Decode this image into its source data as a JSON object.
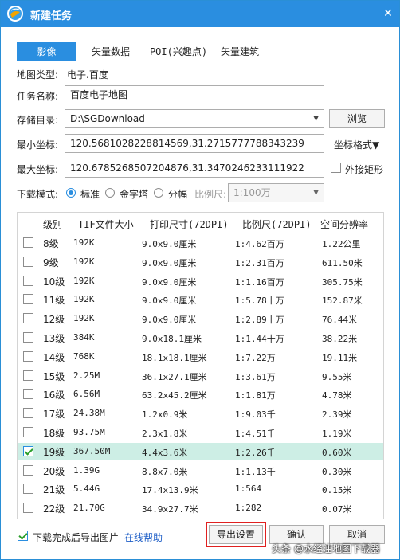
{
  "window": {
    "title": "新建任务",
    "close": "✕"
  },
  "tabs": [
    "影像",
    "矢量数据",
    "POI(兴趣点)",
    "矢量建筑"
  ],
  "map_type": {
    "label": "地图类型:",
    "value": "电子.百度"
  },
  "task_name": {
    "label": "任务名称:",
    "value": "百度电子地图"
  },
  "storage": {
    "label": "存储目录:",
    "value": "D:\\SGDownload",
    "browse": "浏览"
  },
  "min_coord": {
    "label": "最小坐标:",
    "value": "120.5681028228814569,31.2715777788343239"
  },
  "coord_format": "坐标格式▼",
  "max_coord": {
    "label": "最大坐标:",
    "value": "120.6785268507204876,31.3470246233111922"
  },
  "bounding_rect": "外接矩形",
  "download_mode": {
    "label": "下载模式:",
    "options": [
      "标准",
      "金字塔",
      "分幅"
    ],
    "scale_label": "比例尺:",
    "scale_value": "1:100万"
  },
  "table": {
    "headers": [
      "级别",
      "TIF文件大小",
      "打印尺寸(72DPI)",
      "比例尺(72DPI)",
      "空间分辨率"
    ],
    "rows": [
      {
        "level": "8级",
        "size": "192K",
        "print": "9.0x9.0厘米",
        "scale": "1:4.62百万",
        "res": "1.22公里",
        "checked": false
      },
      {
        "level": "9级",
        "size": "192K",
        "print": "9.0x9.0厘米",
        "scale": "1:2.31百万",
        "res": "611.50米",
        "checked": false
      },
      {
        "level": "10级",
        "size": "192K",
        "print": "9.0x9.0厘米",
        "scale": "1:1.16百万",
        "res": "305.75米",
        "checked": false
      },
      {
        "level": "11级",
        "size": "192K",
        "print": "9.0x9.0厘米",
        "scale": "1:5.78十万",
        "res": "152.87米",
        "checked": false
      },
      {
        "level": "12级",
        "size": "192K",
        "print": "9.0x9.0厘米",
        "scale": "1:2.89十万",
        "res": "76.44米",
        "checked": false
      },
      {
        "level": "13级",
        "size": "384K",
        "print": "9.0x18.1厘米",
        "scale": "1:1.44十万",
        "res": "38.22米",
        "checked": false
      },
      {
        "level": "14级",
        "size": "768K",
        "print": "18.1x18.1厘米",
        "scale": "1:7.22万",
        "res": "19.11米",
        "checked": false
      },
      {
        "level": "15级",
        "size": "2.25M",
        "print": "36.1x27.1厘米",
        "scale": "1:3.61万",
        "res": "9.55米",
        "checked": false
      },
      {
        "level": "16级",
        "size": "6.56M",
        "print": "63.2x45.2厘米",
        "scale": "1:1.81万",
        "res": "4.78米",
        "checked": false
      },
      {
        "level": "17级",
        "size": "24.38M",
        "print": "1.2x0.9米",
        "scale": "1:9.03千",
        "res": "2.39米",
        "checked": false
      },
      {
        "level": "18级",
        "size": "93.75M",
        "print": "2.3x1.8米",
        "scale": "1:4.51千",
        "res": "1.19米",
        "checked": false
      },
      {
        "level": "19级",
        "size": "367.50M",
        "print": "4.4x3.6米",
        "scale": "1:2.26千",
        "res": "0.60米",
        "checked": true
      },
      {
        "level": "20级",
        "size": "1.39G",
        "print": "8.8x7.0米",
        "scale": "1:1.13千",
        "res": "0.30米",
        "checked": false
      },
      {
        "level": "21级",
        "size": "5.44G",
        "print": "17.4x13.9米",
        "scale": "1:564",
        "res": "0.15米",
        "checked": false
      },
      {
        "level": "22级",
        "size": "21.70G",
        "print": "34.9x27.7米",
        "scale": "1:282",
        "res": "0.07米",
        "checked": false
      }
    ]
  },
  "footer": {
    "export_after": "下载完成后导出图片",
    "help": "在线帮助",
    "export_settings": "导出设置",
    "ok": "确认",
    "cancel": "取消"
  },
  "watermark": "头条 @水经注地图下载器",
  "colors": {
    "accent": "#2a8ee0",
    "selected_row": "#cdeee5",
    "highlight_border": "#e02020"
  }
}
